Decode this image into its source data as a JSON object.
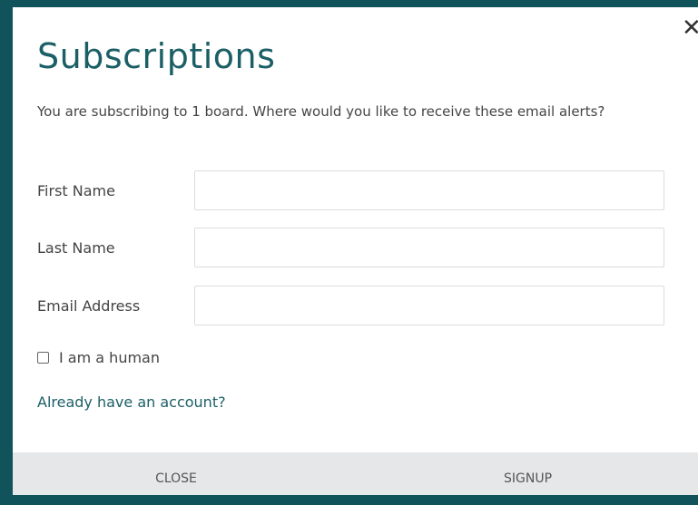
{
  "modal": {
    "title": "Subscriptions",
    "close_icon": "close-icon",
    "close_glyph": "✕",
    "intro": "You are subscribing to 1 board. Where would you like to receive these email alerts?"
  },
  "form": {
    "first_name": {
      "label": "First Name",
      "value": "",
      "placeholder": ""
    },
    "last_name": {
      "label": "Last Name",
      "value": "",
      "placeholder": ""
    },
    "email": {
      "label": "Email Address",
      "value": "",
      "placeholder": ""
    },
    "captcha_label": "I am a human",
    "account_link": "Already have an account?"
  },
  "footer": {
    "close_label": "CLOSE",
    "signup_label": "SIGNUP"
  },
  "colors": {
    "backdrop": "#11535b",
    "accent": "#1b5f66",
    "footer_bg": "#e6e7e9"
  }
}
